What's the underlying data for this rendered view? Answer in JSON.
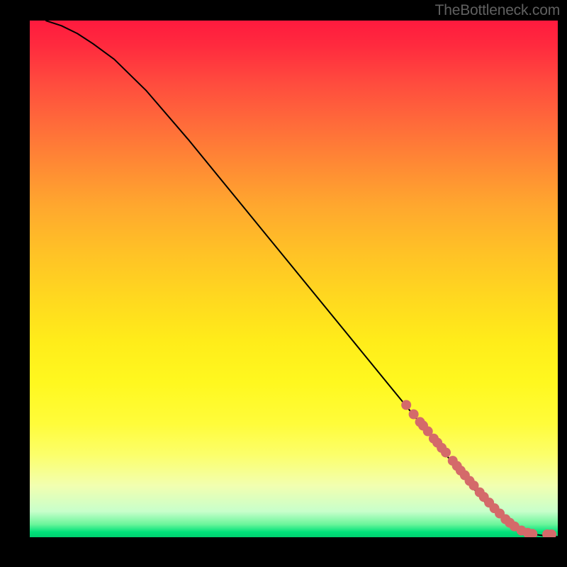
{
  "watermark": "TheBottleneck.com",
  "chart_data": {
    "type": "line",
    "title": "",
    "xlabel": "",
    "ylabel": "",
    "xlim": [
      0,
      100
    ],
    "ylim": [
      0,
      100
    ],
    "grid": false,
    "legend": false,
    "series": [
      {
        "name": "curve",
        "type": "line",
        "x": [
          3,
          6,
          9,
          12,
          16,
          22,
          30,
          40,
          50,
          60,
          68,
          72,
          76,
          80,
          82,
          84,
          86,
          88,
          90,
          92,
          94,
          96,
          98,
          100
        ],
        "y": [
          100,
          99,
          97.5,
          95.5,
          92.5,
          86.5,
          77,
          64.5,
          52,
          39.5,
          29.5,
          24.5,
          19.5,
          14.5,
          12,
          9.5,
          7,
          5,
          3.3,
          2,
          1.1,
          0.5,
          0.2,
          0.1
        ]
      },
      {
        "name": "bottleneck-markers",
        "type": "scatter",
        "x": [
          71.3,
          72.7,
          73.9,
          74.5,
          75.4,
          76.5,
          77.2,
          78.0,
          78.8,
          80.1,
          80.9,
          81.6,
          82.4,
          83.3,
          84.1,
          85.2,
          86.0,
          87.0,
          88.0,
          89.0,
          90.1,
          90.9,
          91.8,
          93.1,
          94.3,
          95.2,
          98.0,
          98.8
        ],
        "y": [
          25.6,
          23.8,
          22.3,
          21.6,
          20.5,
          19.1,
          18.3,
          17.3,
          16.4,
          14.8,
          13.8,
          12.9,
          12.0,
          10.9,
          10.0,
          8.7,
          7.8,
          6.7,
          5.6,
          4.6,
          3.5,
          2.8,
          2.1,
          1.3,
          0.85,
          0.65,
          0.55,
          0.55
        ]
      }
    ],
    "background_gradient": {
      "top": "#ff1a3e",
      "mid": "#ffe81c",
      "bottom": "#00d070"
    },
    "marker_color": "#d46a6a",
    "line_color": "#000000"
  }
}
